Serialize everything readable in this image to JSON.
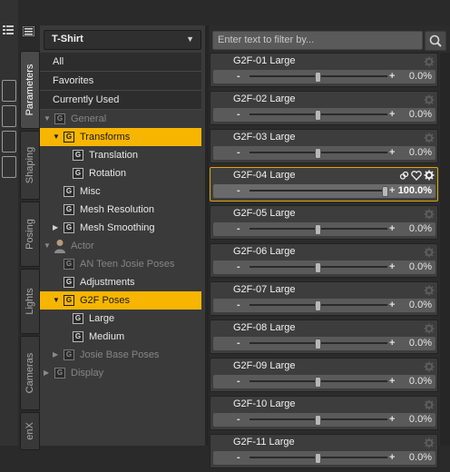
{
  "tabs": [
    "Parameters",
    "Shaping",
    "Posing",
    "Lights",
    "Cameras",
    "enX"
  ],
  "dropdown": {
    "value": "T-Shirt"
  },
  "filter": {
    "placeholder": "Enter text to filter by..."
  },
  "tree": [
    {
      "label": "All",
      "style": "top"
    },
    {
      "label": "Favorites",
      "style": "top"
    },
    {
      "label": "Currently Used",
      "style": "top"
    },
    {
      "label": "General",
      "grey": true
    },
    {
      "label": "Transforms",
      "selected": true
    },
    {
      "label": "Translation"
    },
    {
      "label": "Rotation"
    },
    {
      "label": "Misc"
    },
    {
      "label": "Mesh Resolution"
    },
    {
      "label": "Mesh Smoothing"
    },
    {
      "label": "Actor",
      "grey": true
    },
    {
      "label": "AN Teen Josie Poses",
      "grey": true
    },
    {
      "label": "Adjustments"
    },
    {
      "label": "G2F Poses",
      "selected": true
    },
    {
      "label": "Large"
    },
    {
      "label": "Medium"
    },
    {
      "label": "Josie Base Poses",
      "grey": true
    },
    {
      "label": "Display",
      "grey": true
    }
  ],
  "properties": [
    {
      "name": "G2F-01 Large",
      "value": "0.0%",
      "level": 0.5
    },
    {
      "name": "G2F-02 Large",
      "value": "0.0%",
      "level": 0.5
    },
    {
      "name": "G2F-03 Large",
      "value": "0.0%",
      "level": 0.5
    },
    {
      "name": "G2F-04 Large",
      "value": "100.0%",
      "level": 1.0,
      "active": true
    },
    {
      "name": "G2F-05 Large",
      "value": "0.0%",
      "level": 0.5
    },
    {
      "name": "G2F-06 Large",
      "value": "0.0%",
      "level": 0.5
    },
    {
      "name": "G2F-07 Large",
      "value": "0.0%",
      "level": 0.5
    },
    {
      "name": "G2F-08 Large",
      "value": "0.0%",
      "level": 0.5
    },
    {
      "name": "G2F-09 Large",
      "value": "0.0%",
      "level": 0.5
    },
    {
      "name": "G2F-10 Large",
      "value": "0.0%",
      "level": 0.5
    },
    {
      "name": "G2F-11 Large",
      "value": "0.0%",
      "level": 0.5
    }
  ],
  "slider": {
    "minus": "-",
    "plus": "+"
  },
  "icons": {
    "menu": "menu-icon",
    "search": "search-icon",
    "gear": "gear-icon",
    "link": "link-icon",
    "heart": "heart-icon",
    "group": "group-icon",
    "actor": "actor-icon"
  },
  "colors": {
    "selection": "#f7b500",
    "active_border": "#e0a800"
  }
}
